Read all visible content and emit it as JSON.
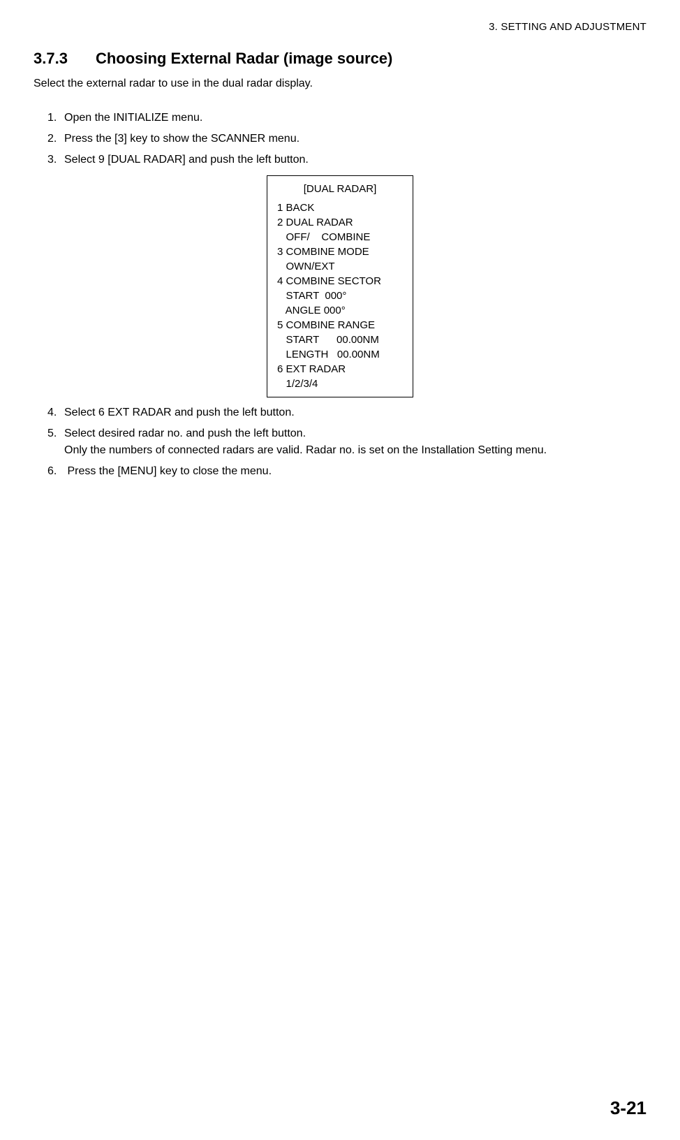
{
  "header": {
    "running": "3. SETTING AND ADJUSTMENT"
  },
  "section": {
    "number": "3.7.3",
    "title": "Choosing External Radar (image source)",
    "intro": "Select the external radar to use in the dual radar display."
  },
  "steps_a": [
    "Open the INITIALIZE menu.",
    "Press the [3] key to show the SCANNER menu.",
    "Select 9 [DUAL RADAR] and push the left button."
  ],
  "menu": {
    "title": "[DUAL  RADAR]",
    "lines": [
      "1 BACK",
      "2 DUAL RADAR",
      "   OFF/    COMBINE",
      "3 COMBINE MODE",
      "   OWN/EXT",
      "4 COMBINE SECTOR",
      "   START  000°",
      "   ANGLE 000°",
      "5 COMBINE RANGE",
      "   START      00.00NM",
      "   LENGTH   00.00NM",
      "6 EXT RADAR",
      "   1/2/3/4"
    ]
  },
  "steps_b": [
    {
      "num": "4.",
      "text": "Select 6 EXT RADAR and push the left button.",
      "note": ""
    },
    {
      "num": "5.",
      "text": "Select desired radar no. and push the left button.",
      "note": "Only the numbers of connected radars are valid. Radar no. is set on the Installation Setting menu."
    },
    {
      "num": "6.",
      "text": "Press the [MENU] key to close the menu.",
      "note": ""
    }
  ],
  "page_number": "3-21"
}
